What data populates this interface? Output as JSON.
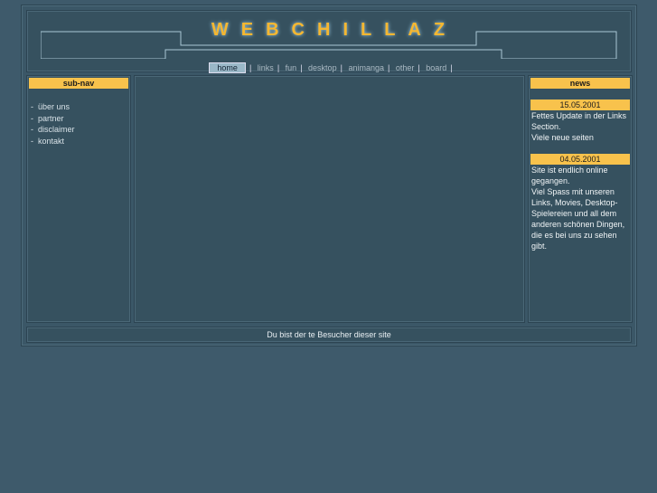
{
  "logo": "WEBCHILLAZ",
  "nav": [
    "home",
    "links",
    "fun",
    "desktop",
    "animanga",
    "other",
    "board"
  ],
  "subnav": {
    "title": "sub-nav",
    "items": [
      "über uns",
      "partner",
      "disclaimer",
      "kontakt"
    ]
  },
  "news": {
    "title": "news",
    "entries": [
      {
        "date": "15.05.2001",
        "lines": [
          "Fettes Update in der Links",
          "Section.",
          "Viele neue seiten"
        ]
      },
      {
        "date": "04.05.2001",
        "lines": [
          "Site ist endlich online",
          "gegangen.",
          "Viel Spass mit unseren",
          "Links, Movies, Desktop-",
          "Spielereien und all dem",
          "anderen schönen Dingen,",
          "die es bei uns zu sehen gibt."
        ]
      }
    ]
  },
  "footer": "Du bist der te Besucher dieser site",
  "colors": {
    "accent": "#f8c24c",
    "bg": "#3e5a6b"
  }
}
